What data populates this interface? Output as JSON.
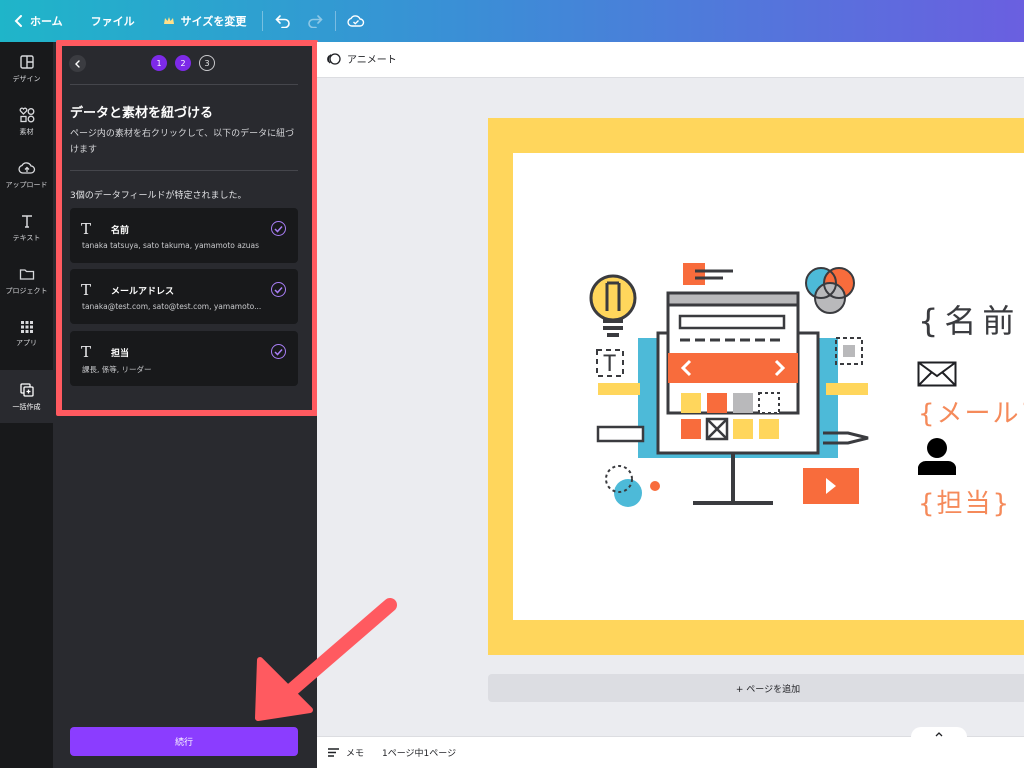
{
  "topbar": {
    "home_label": "ホーム",
    "file_label": "ファイル",
    "resize_label": "サイズを変更"
  },
  "rail": {
    "items": [
      {
        "label": "デザイン",
        "icon": "layout-icon"
      },
      {
        "label": "素材",
        "icon": "shapes-icon"
      },
      {
        "label": "アップロード",
        "icon": "upload-cloud-icon"
      },
      {
        "label": "テキスト",
        "icon": "text-icon"
      },
      {
        "label": "プロジェクト",
        "icon": "folder-icon"
      },
      {
        "label": "アプリ",
        "icon": "apps-grid-icon"
      },
      {
        "label": "一括作成",
        "icon": "bulk-create-icon"
      }
    ]
  },
  "panel": {
    "steps": [
      "1",
      "2",
      "3"
    ],
    "title": "データと素材を紐づける",
    "description": "ページ内の素材を右クリックして、以下のデータに紐づけます",
    "count_text": "3個のデータフィールドが特定されました。",
    "fields": [
      {
        "name": "名前",
        "values": "tanaka tatsuya, sato takuma, yamamoto azuas"
      },
      {
        "name": "メールアドレス",
        "values": "tanaka@test.com, sato@test.com, yamamoto..."
      },
      {
        "name": "担当",
        "values": "課長, 係等, リーダー"
      }
    ],
    "continue_label": "続行"
  },
  "context_bar": {
    "animate_label": "アニメート"
  },
  "design": {
    "placeholder_name": "{名前}",
    "placeholder_mail": "{メールア",
    "placeholder_charge": "{担当}",
    "colors": {
      "frame": "#ffd65c",
      "accent": "#f58a5a",
      "brand_purple": "#8b3dff",
      "highlight_red": "#ff5a60"
    }
  },
  "canvas": {
    "add_page_label": "+ ページを追加"
  },
  "bottombar": {
    "memo_label": "メモ",
    "page_count": "1ページ中1ページ"
  }
}
